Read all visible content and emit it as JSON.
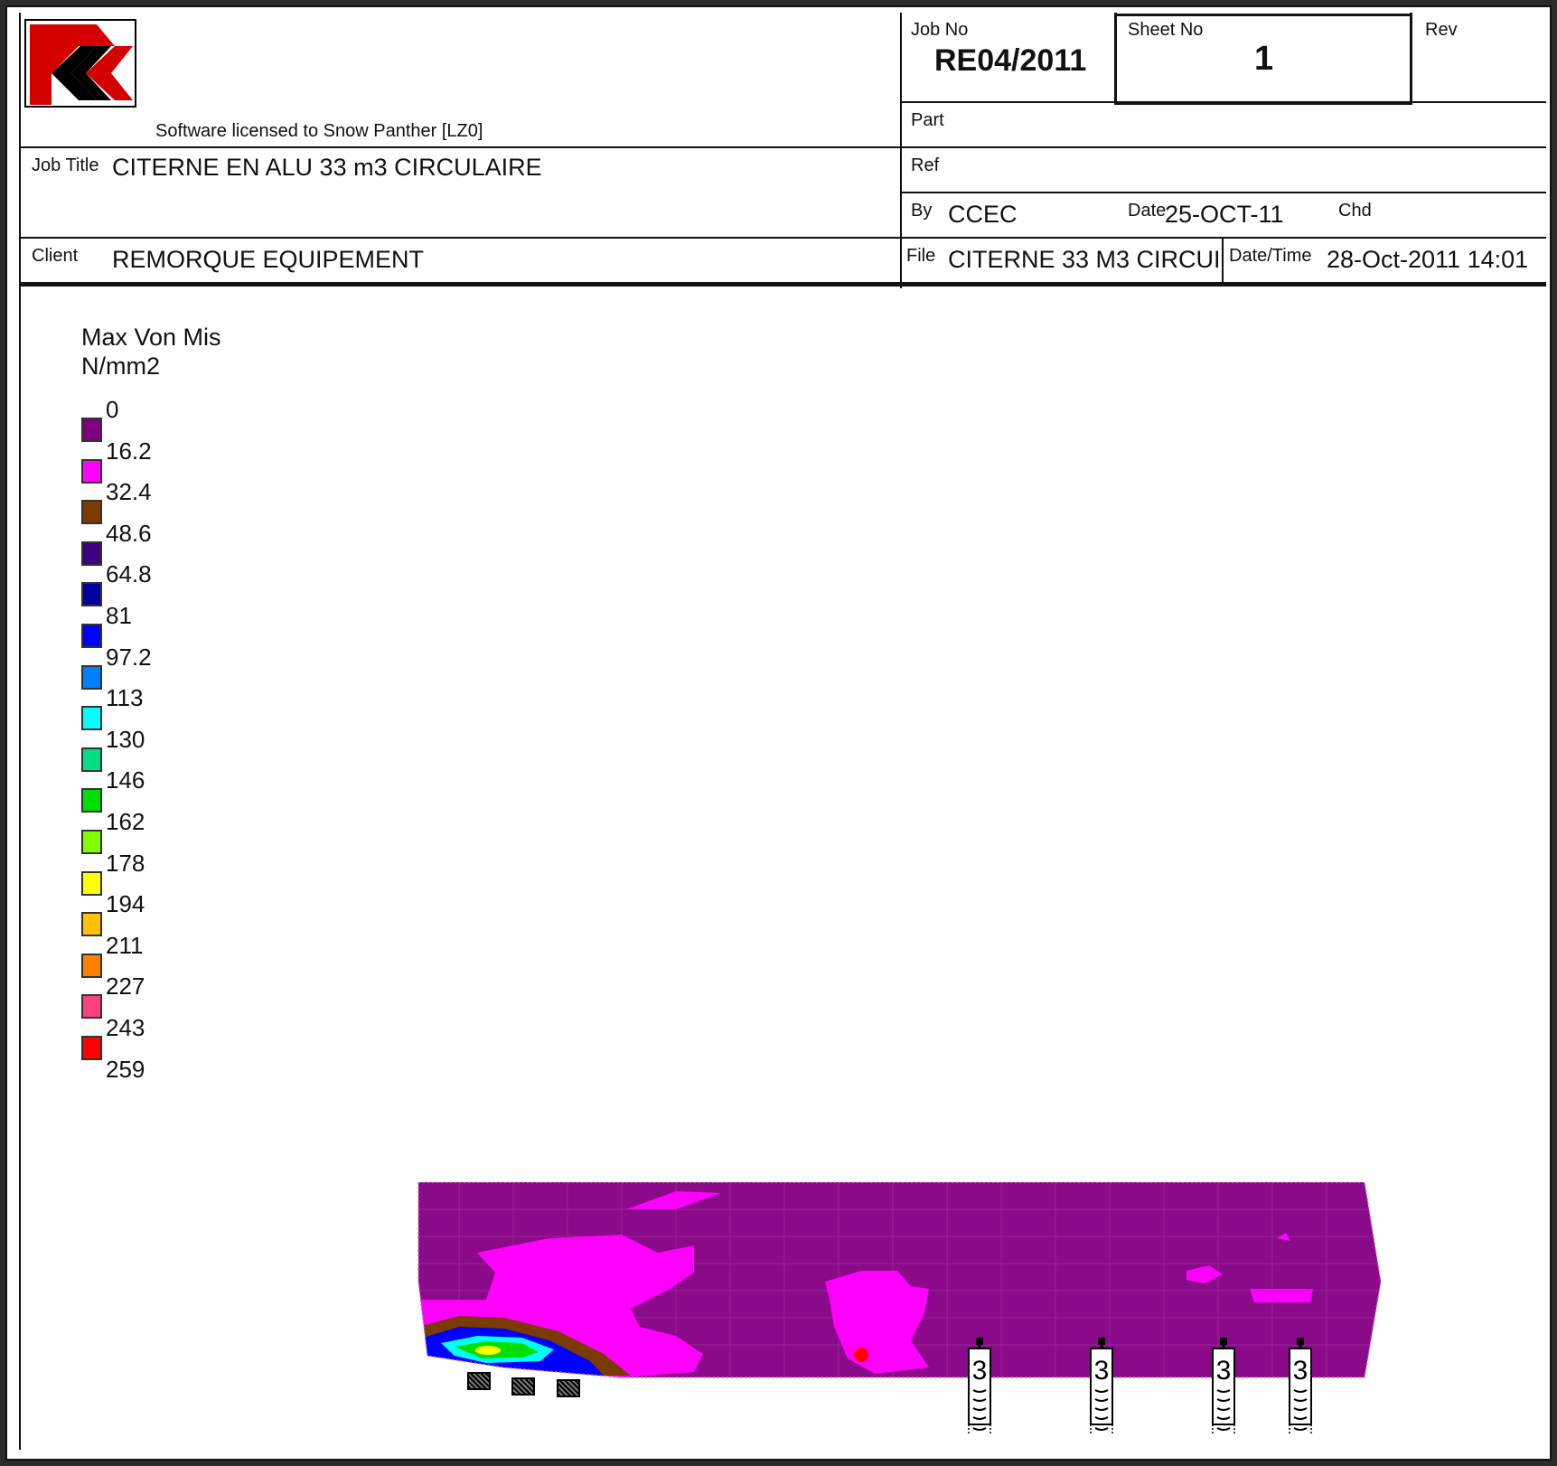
{
  "header": {
    "license_text": "Software licensed to Snow Panther [LZ0]",
    "job_no_label": "Job No",
    "job_no": "RE04/2011",
    "sheet_no_label": "Sheet No",
    "sheet_no": "1",
    "rev_label": "Rev",
    "rev": "",
    "part_label": "Part",
    "part": "",
    "job_title_label": "Job Title",
    "job_title": "CITERNE EN ALU 33 m3 CIRCULAIRE",
    "ref_label": "Ref",
    "ref": "",
    "by_label": "By",
    "by": "CCEC",
    "date_label": "Date",
    "date": "25-OCT-11",
    "chd_label": "Chd",
    "chd": "",
    "client_label": "Client",
    "client": "REMORQUE EQUIPEMENT",
    "file_label": "File",
    "file": "CITERNE 33 M3  CIRCUI",
    "datetime_label": "Date/Time",
    "datetime": "28-Oct-2011 14:01"
  },
  "legend": {
    "title_line1": "Max Von Mis",
    "title_line2": "N/mm2",
    "ticks": [
      "0",
      "16.2",
      "32.4",
      "48.6",
      "64.8",
      "81",
      "97.2",
      "113",
      "130",
      "146",
      "162",
      "178",
      "194",
      "211",
      "227",
      "243",
      "259"
    ],
    "colors": [
      "#800080",
      "#ff00ff",
      "#7a3a00",
      "#3c0080",
      "#0000a0",
      "#0000ff",
      "#0080ff",
      "#00ffff",
      "#00e080",
      "#00e000",
      "#80ff00",
      "#ffff00",
      "#ffc000",
      "#ff8000",
      "#ff4080",
      "#ff0000"
    ]
  },
  "model": {
    "support_label": "3",
    "colors": {
      "base": "#8a0a8a",
      "high": "#ff00ff",
      "brown": "#7a3a00",
      "blue": "#0000ff",
      "cyan": "#00ffff",
      "green": "#00e000",
      "yellow": "#ffff00",
      "marker": "#ff0000"
    }
  }
}
